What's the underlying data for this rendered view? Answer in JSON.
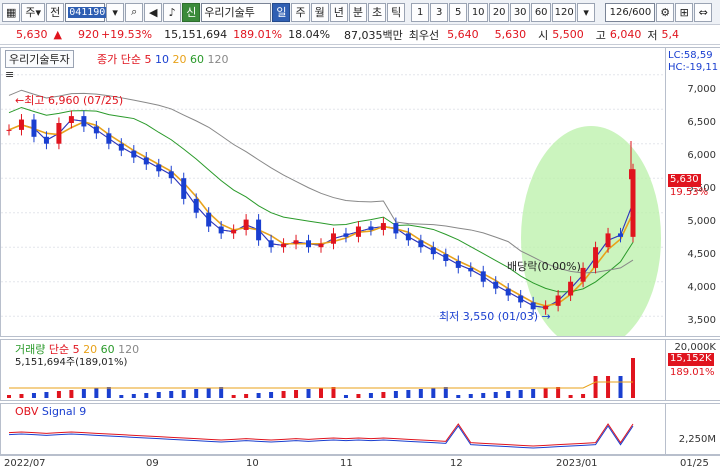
{
  "toolbar": {
    "market_label": "주",
    "prev_label": "전",
    "stock_code": "041190",
    "stock_name": "우리기술투",
    "sin_badge": "신",
    "periods": [
      "일",
      "주",
      "월",
      "년",
      "분",
      "초",
      "틱"
    ],
    "selected_period": "일",
    "intervals": [
      "1",
      "3",
      "5",
      "10",
      "20",
      "30",
      "60",
      "120"
    ],
    "count": "126/600"
  },
  "quote": {
    "price": "5,630",
    "arrow": "▲",
    "change": "920",
    "change_pct": "+19.53%",
    "volume": "15,151,694",
    "volume_ratio": "189.01%",
    "turnover": "18.04%",
    "amount": "87,035백만",
    "best_ask_label": "최우선",
    "best_ask": "5,640",
    "best_bid": "5,630",
    "open_label": "시",
    "open": "5,500",
    "high_label": "고",
    "high": "6,040",
    "low_label": "저",
    "low": "5,4"
  },
  "price_panel": {
    "title": "우리기술투자",
    "ma_label": "종가 단순",
    "ma_periods": [
      "5",
      "10",
      "20",
      "60",
      "120"
    ],
    "ma_colors": [
      "#e0141e",
      "#1a3fd0",
      "#e8a21a",
      "#2a9a2a",
      "#888888"
    ],
    "lc_label": "LC:58,59",
    "hc_label": "HC:-19,11",
    "high_marker": "최고 6,960 (07/25)",
    "low_marker": "최저 3,550 (01/03)",
    "dividend_marker": "배당락(0.00%)",
    "y_ticks": [
      "7,000",
      "6,500",
      "6,000",
      "5,500",
      "5,000",
      "4,500",
      "4,000",
      "3,500"
    ],
    "last_price_tag": "5,630",
    "last_pct_tag": "19.53%"
  },
  "volume_panel": {
    "title": "거래량",
    "ma_label": "단순",
    "ma_periods": [
      "5",
      "20",
      "60",
      "120"
    ],
    "summary": "5,151,694주(189,01%)",
    "y_tick": "20,000K",
    "last_tag": "15,152K",
    "last_pct": "189.01%"
  },
  "obv_panel": {
    "title": "OBV",
    "signal_label": "Signal 9",
    "y_tick": "2,250M"
  },
  "dates": [
    "2022/07",
    "09",
    "10",
    "11",
    "12",
    "2023/01",
    "01/25"
  ],
  "chart_data": {
    "type": "candlestick",
    "series_ohlc_close_approx": [
      6200,
      6350,
      6100,
      6000,
      6300,
      6400,
      6250,
      6150,
      6000,
      5900,
      5800,
      5700,
      5600,
      5500,
      5200,
      5000,
      4800,
      4700,
      4750,
      4900,
      4600,
      4500,
      4550,
      4600,
      4500,
      4550,
      4700,
      4650,
      4800,
      4750,
      4850,
      4700,
      4600,
      4500,
      4400,
      4300,
      4200,
      4150,
      4000,
      3900,
      3800,
      3700,
      3600,
      3650,
      3800,
      4000,
      4200,
      4500,
      4700,
      4650,
      5630
    ],
    "ylim": [
      3300,
      7300
    ],
    "high": 6960,
    "low": 3550,
    "last": 5630
  }
}
